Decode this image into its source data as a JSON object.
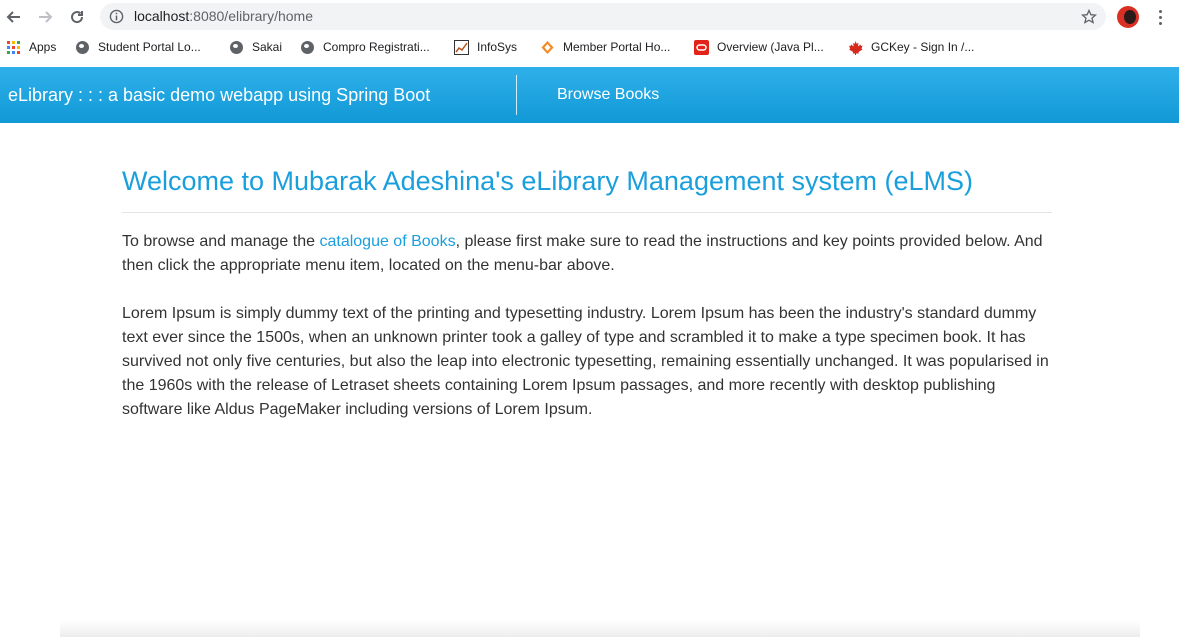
{
  "browser": {
    "url_host": "localhost",
    "url_path": ":8080/elibrary/home",
    "bookmarks": [
      {
        "label": "Apps",
        "icon": "apps-grid-icon"
      },
      {
        "label": "Student Portal Lo...",
        "icon": "globe-icon"
      },
      {
        "label": "Sakai",
        "icon": "globe-icon"
      },
      {
        "label": "Compro Registrati...",
        "icon": "globe-icon"
      },
      {
        "label": "InfoSys",
        "icon": "chart-icon"
      },
      {
        "label": "Member Portal Ho...",
        "icon": "diamond-icon"
      },
      {
        "label": "Overview (Java Pl...",
        "icon": "oracle-icon"
      },
      {
        "label": "GCKey - Sign In /...",
        "icon": "maple-leaf-icon"
      }
    ]
  },
  "navbar": {
    "brand": "eLibrary : : : a basic demo webapp using Spring Boot",
    "browse_books": "Browse Books",
    "color": "#1aa3df"
  },
  "content": {
    "heading": "Welcome to Mubarak Adeshina's eLibrary Management system (eLMS)",
    "intro_before": "To browse and manage the ",
    "intro_link": "catalogue of Books",
    "intro_after": ", please first make sure to read the instructions and key points provided below. And then click the appropriate menu item, located on the menu-bar above.",
    "lorem": "Lorem Ipsum is simply dummy text of the printing and typesetting industry. Lorem Ipsum has been the industry's standard dummy text ever since the 1500s, when an unknown printer took a galley of type and scrambled it to make a type specimen book. It has survived not only five centuries, but also the leap into electronic typesetting, remaining essentially unchanged. It was popularised in the 1960s with the release of Letraset sheets containing Lorem Ipsum passages, and more recently with desktop publishing software like Aldus PageMaker including versions of Lorem Ipsum.",
    "accent_color": "#1a9fdc"
  }
}
